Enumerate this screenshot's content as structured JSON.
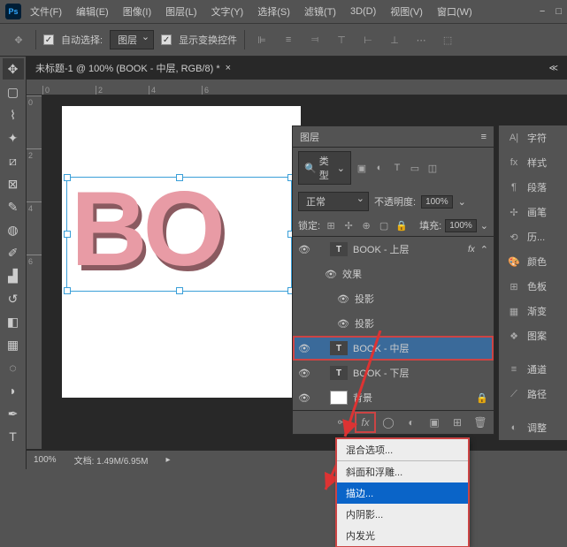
{
  "menu": [
    "文件(F)",
    "编辑(E)",
    "图像(I)",
    "图层(L)",
    "文字(Y)",
    "选择(S)",
    "滤镜(T)",
    "3D(D)",
    "视图(V)",
    "窗口(W)"
  ],
  "options": {
    "auto_select": "自动选择:",
    "target": "图层",
    "show_transform": "显示变换控件"
  },
  "doc_tab": "未标题-1 @ 100% (BOOK - 中层, RGB/8) *",
  "canvas_text": "BO",
  "ruler_h": [
    "0",
    "2",
    "4",
    "6"
  ],
  "ruler_v": [
    "0",
    "2",
    "4",
    "6"
  ],
  "status": {
    "zoom": "100%",
    "file": "文档: 1.49M/6.95M"
  },
  "layers": {
    "title": "图层",
    "search_label": "类型",
    "blend_mode": "正常",
    "opacity_label": "不透明度:",
    "opacity_value": "100%",
    "lock_label": "锁定:",
    "fill_label": "填充:",
    "fill_value": "100%",
    "items": [
      {
        "name": "BOOK - 上层",
        "type": "text",
        "fx": true,
        "expanded": false
      },
      {
        "name": "效果",
        "type": "fx-group",
        "indent": 1
      },
      {
        "name": "投影",
        "type": "fx-item",
        "indent": 2
      },
      {
        "name": "投影",
        "type": "fx-item",
        "indent": 2
      },
      {
        "name": "BOOK - 中层",
        "type": "text",
        "selected": true,
        "highlighted": true
      },
      {
        "name": "BOOK - 下层",
        "type": "text"
      },
      {
        "name": "背景",
        "type": "bg",
        "locked": true
      }
    ]
  },
  "fx_menu": [
    "混合选项...",
    "斜面和浮雕...",
    "描边...",
    "内阴影...",
    "内发光"
  ],
  "right_panels": [
    "字符",
    "样式",
    "段落",
    "画笔",
    "历...",
    "颜色",
    "色板",
    "渐变",
    "图案",
    "通道",
    "路径",
    "调整"
  ],
  "right_icons": [
    "A|",
    "fx",
    "¶",
    "✢",
    "⟲",
    "🎨",
    "⊞",
    "▦",
    "❖",
    "≡",
    "⟋",
    "◐"
  ]
}
